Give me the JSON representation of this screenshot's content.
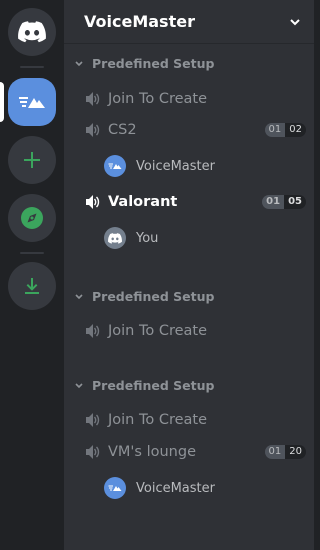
{
  "server": {
    "name": "VoiceMaster"
  },
  "rail": {
    "items": [
      {
        "icon": "discord-logo-icon"
      },
      {
        "icon": "voicemaster-server-icon"
      },
      {
        "icon": "add-server-icon"
      },
      {
        "icon": "explore-compass-icon"
      },
      {
        "icon": "download-icon"
      }
    ]
  },
  "categories": [
    {
      "name": "Predefined Setup",
      "channels": [
        {
          "name": "Join To Create"
        },
        {
          "name": "CS2",
          "count_a": "01",
          "count_b": "02",
          "users": [
            {
              "name": "VoiceMaster"
            }
          ]
        },
        {
          "name": "Valorant",
          "count_a": "01",
          "count_b": "05",
          "users": [
            {
              "name": "You"
            }
          ]
        }
      ]
    },
    {
      "name": "Predefined Setup",
      "channels": [
        {
          "name": "Join To Create"
        }
      ]
    },
    {
      "name": "Predefined Setup",
      "channels": [
        {
          "name": "Join To Create"
        },
        {
          "name": "VM's lounge",
          "count_a": "01",
          "count_b": "20",
          "users": [
            {
              "name": "VoiceMaster"
            }
          ]
        }
      ]
    }
  ],
  "colors": {
    "accent": "#5b8fde",
    "green": "#3ba55d",
    "bg_rail": "#202225",
    "bg_panel": "#2f3136"
  }
}
